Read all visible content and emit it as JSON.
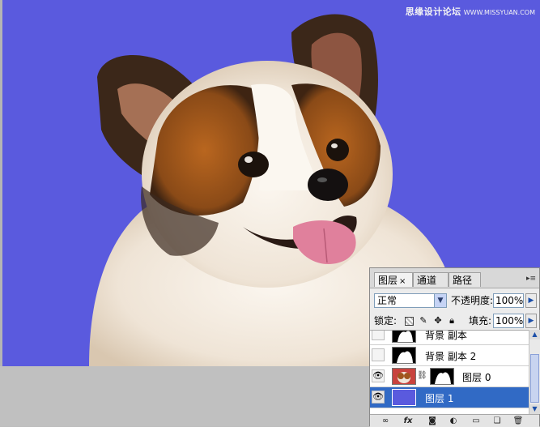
{
  "watermark": {
    "text": "思缘设计论坛",
    "url": "WWW.MISSYUAN.COM"
  },
  "canvas": {
    "background_color": "#5a5ade"
  },
  "layers_panel": {
    "tabs": [
      {
        "label": "图层",
        "close": "×",
        "active": true
      },
      {
        "label": "通道",
        "active": false
      },
      {
        "label": "路径",
        "active": false
      }
    ],
    "blend_mode": "正常",
    "opacity_label": "不透明度:",
    "opacity_value": "100%",
    "lock_label": "锁定:",
    "fill_label": "填充:",
    "fill_value": "100%",
    "layers": [
      {
        "name": "背景 副本",
        "visible": false,
        "thumb": "mask-white-shape"
      },
      {
        "name": "背景 副本 2",
        "visible": false,
        "thumb": "mask-white-shape"
      },
      {
        "name": "图层 0",
        "visible": true,
        "thumb": "dog-photo",
        "has_mask": true
      },
      {
        "name": "图层 1",
        "visible": true,
        "thumb": "blue-fill",
        "selected": true
      }
    ],
    "footer_icons": [
      "link-icon",
      "fx-icon",
      "mask-icon",
      "adjustment-icon",
      "group-icon",
      "new-layer-icon",
      "trash-icon"
    ]
  }
}
